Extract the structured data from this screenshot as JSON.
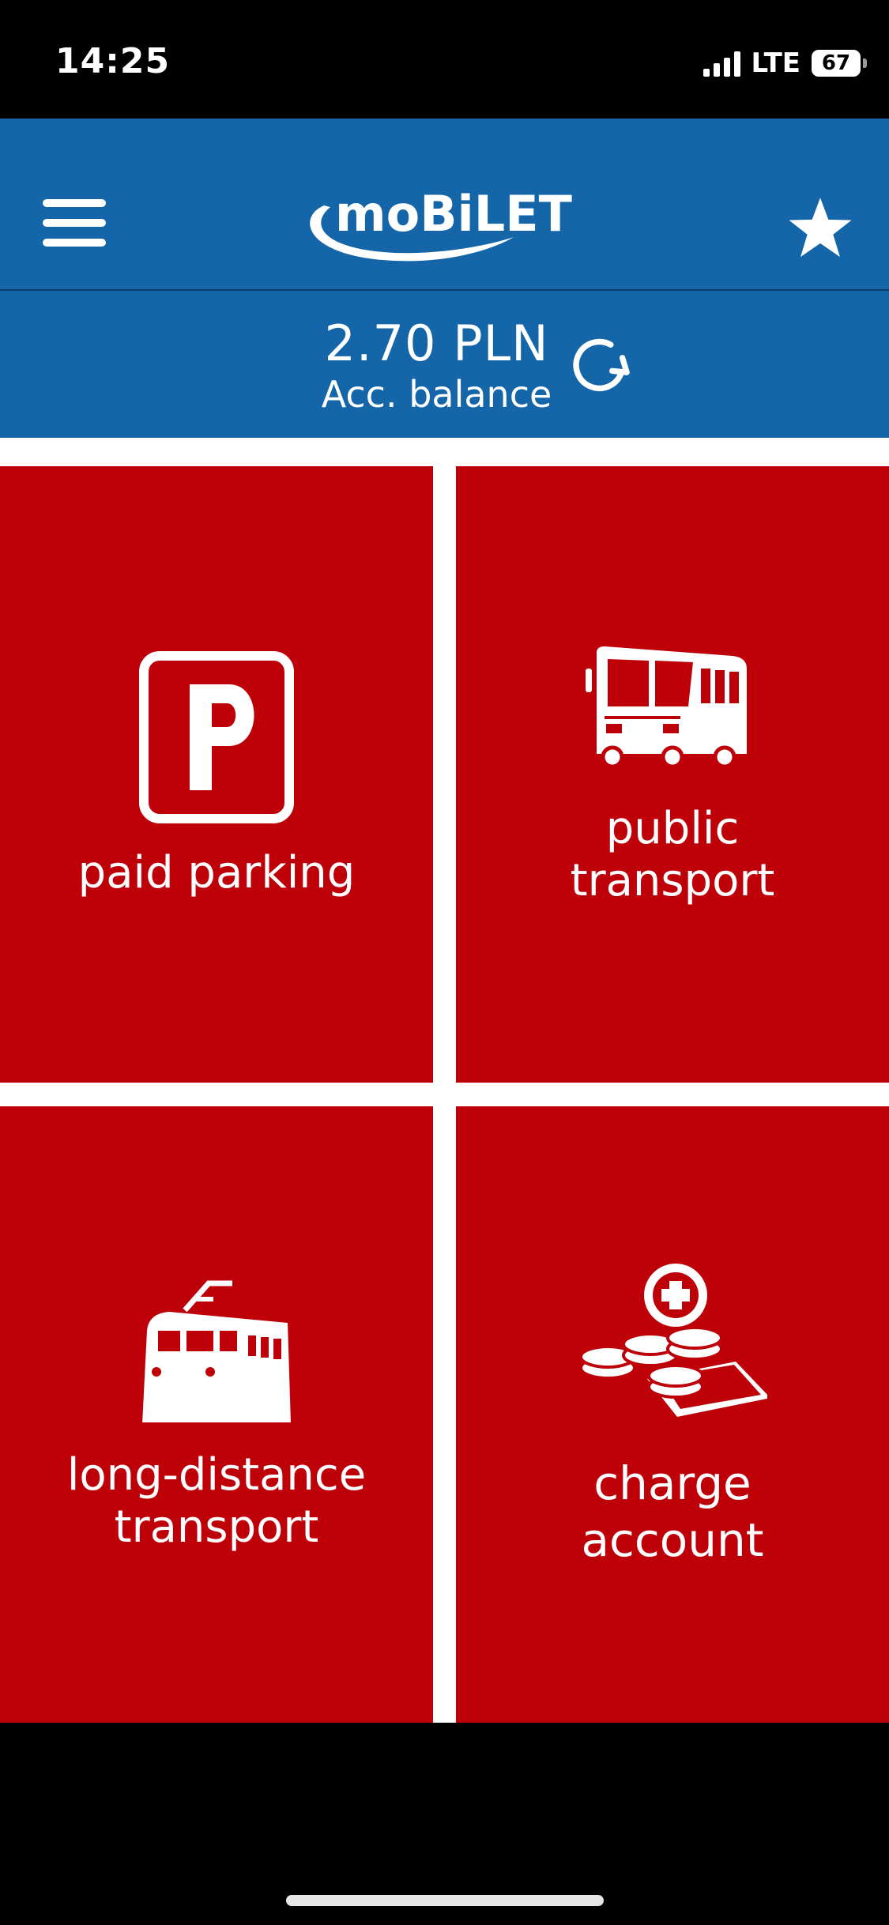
{
  "status_bar": {
    "time": "14:25",
    "network": "LTE",
    "battery": "67"
  },
  "header": {
    "logo_text": "moBiLET"
  },
  "balance": {
    "amount": "2.70 PLN",
    "label": "Acc. balance"
  },
  "tiles": [
    {
      "label": "paid parking",
      "icon": "parking-icon"
    },
    {
      "label": "public\ntransport",
      "icon": "bus-icon"
    },
    {
      "label": "long-distance\ntransport",
      "icon": "train-icon"
    },
    {
      "label": "charge\naccount",
      "icon": "coins-plus-icon"
    }
  ],
  "colors": {
    "header_blue": "#1565a9",
    "tile_red": "#be0009",
    "background": "#ffffff"
  }
}
